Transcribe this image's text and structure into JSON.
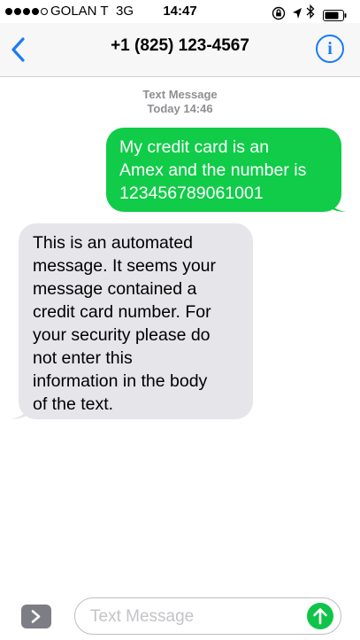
{
  "status_bar": {
    "carrier": "GOLAN T",
    "network": "3G",
    "time": "14:47",
    "signal_bars_filled": 4,
    "signal_bars_total": 5
  },
  "nav": {
    "title": "+1 (825) 123-4567",
    "info_glyph": "i",
    "accent_color": "#1a7cf5"
  },
  "conversation": {
    "header_label": "Text Message",
    "header_time": "Today 14:46",
    "messages": [
      {
        "direction": "outgoing",
        "lines": [
          "My credit card is an",
          "Amex and the number is",
          "123456789061001"
        ],
        "color": "#10cc48"
      },
      {
        "direction": "incoming",
        "lines": [
          "This is an automated",
          "message. It seems your",
          "message contained a",
          "credit card number. For",
          "your security please do",
          "not enter this",
          "information in the body",
          "of the text."
        ],
        "color": "#e5e5ea"
      }
    ]
  },
  "composer": {
    "placeholder": "Text Message",
    "send_color": "#11c449"
  },
  "icons": {
    "back": "chevron-left-icon",
    "info": "info-icon",
    "lock": "rotation-lock-icon",
    "location": "location-arrow-icon",
    "bluetooth": "bluetooth-icon",
    "battery": "battery-icon",
    "expand": "chevron-right-icon",
    "send": "arrow-up-icon"
  }
}
